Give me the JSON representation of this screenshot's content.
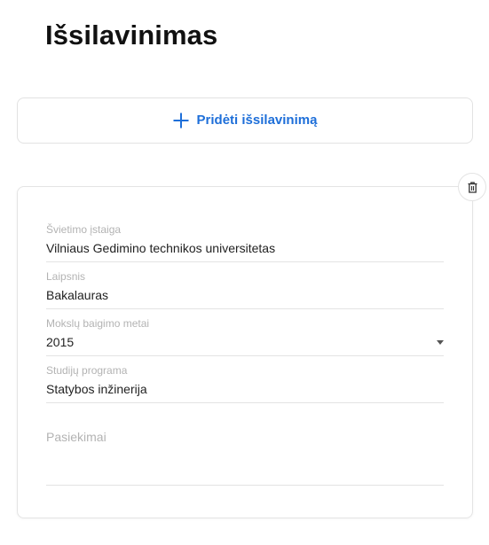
{
  "page": {
    "title": "Išsilavinimas"
  },
  "add_button": {
    "label": "Pridėti išsilavinimą",
    "icon": "plus-icon",
    "color": "#1e6fd9"
  },
  "education_entry": {
    "delete_icon": "trash-icon",
    "fields": {
      "institution": {
        "label": "Švietimo įstaiga",
        "value": "Vilniaus Gedimino technikos universitetas"
      },
      "degree": {
        "label": "Laipsnis",
        "value": "Bakalauras"
      },
      "graduation_year": {
        "label": "Mokslų baigimo metai",
        "value": "2015"
      },
      "study_program": {
        "label": "Studijų programa",
        "value": "Statybos inžinerija"
      },
      "achievements": {
        "placeholder": "Pasiekimai",
        "value": ""
      }
    }
  }
}
